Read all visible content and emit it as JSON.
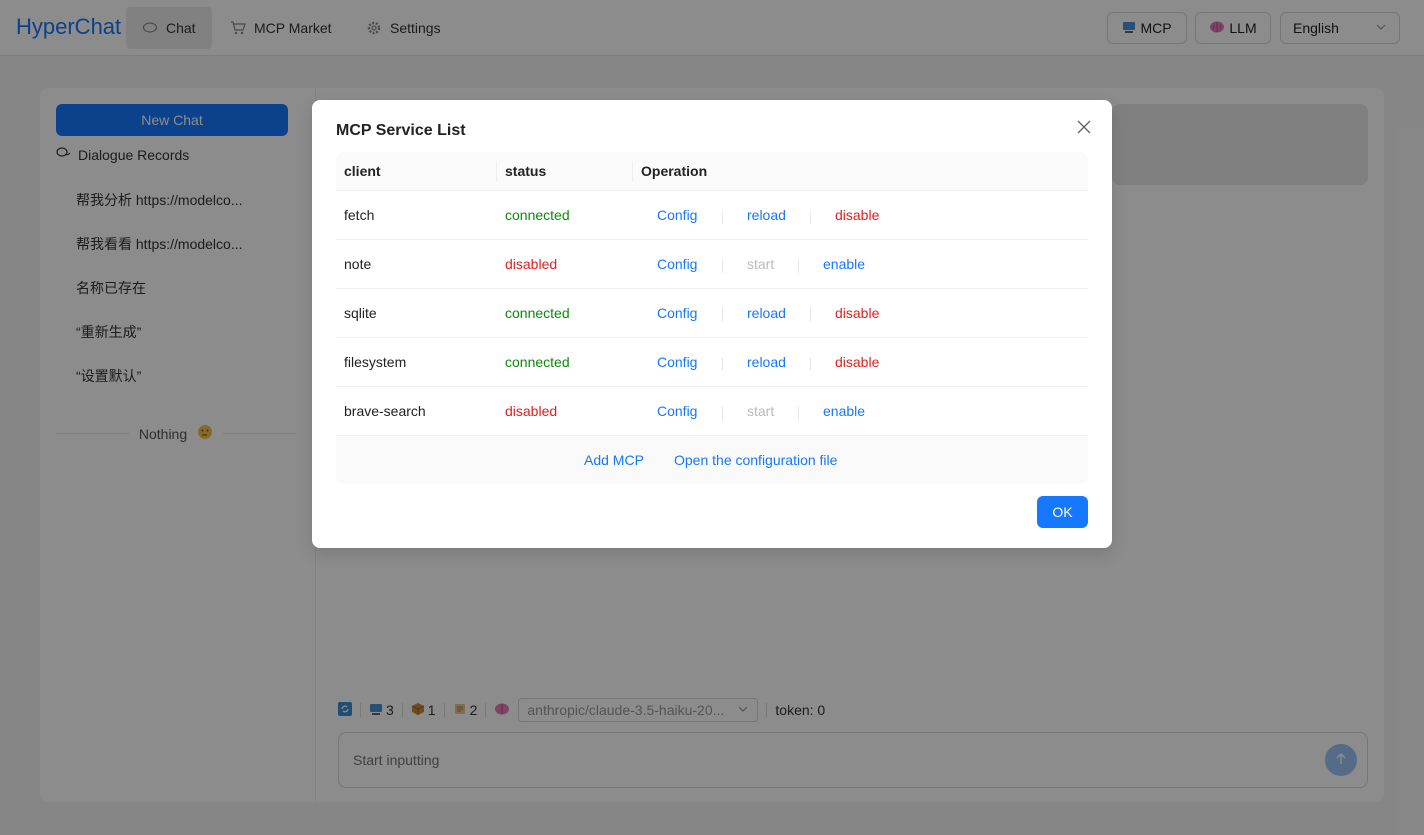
{
  "app": {
    "title": "HyperChat"
  },
  "nav": {
    "tabs": [
      {
        "label": "Chat",
        "icon": "chat-bubble-icon"
      },
      {
        "label": "MCP Market",
        "icon": "cart-icon"
      },
      {
        "label": "Settings",
        "icon": "gear-icon"
      }
    ]
  },
  "header": {
    "mcp_button": "MCP",
    "llm_button": "LLM",
    "language": "English"
  },
  "sidebar": {
    "new_chat": "New Chat",
    "records_title": "Dialogue Records",
    "records": [
      "帮我分析 https://modelco...",
      "帮我看看 https://modelco...",
      "名称已存在",
      "“重新生成”",
      "“设置默认”"
    ],
    "nothing": "Nothing"
  },
  "toolbar": {
    "mcp_count": "3",
    "tool_count": "1",
    "prompt_count": "2",
    "model": "anthropic/claude-3.5-haiku-20...",
    "token": "token: 0"
  },
  "input": {
    "placeholder": "Start inputting"
  },
  "modal": {
    "title": "MCP Service List",
    "columns": [
      "client",
      "status",
      "Operation"
    ],
    "rows": [
      {
        "client": "fetch",
        "status": "connected",
        "config": "Config",
        "action1": "reload",
        "action2": "disable"
      },
      {
        "client": "note",
        "status": "disabled",
        "config": "Config",
        "action1": "start",
        "action2": "enable"
      },
      {
        "client": "sqlite",
        "status": "connected",
        "config": "Config",
        "action1": "reload",
        "action2": "disable"
      },
      {
        "client": "filesystem",
        "status": "connected",
        "config": "Config",
        "action1": "reload",
        "action2": "disable"
      },
      {
        "client": "brave-search",
        "status": "disabled",
        "config": "Config",
        "action1": "start",
        "action2": "enable"
      }
    ],
    "add_mcp": "Add MCP",
    "open_config": "Open the configuration file",
    "ok": "OK"
  },
  "colors": {
    "accent": "#1677ff",
    "connected": "#0a8a0a",
    "disabled": "#e02020"
  }
}
